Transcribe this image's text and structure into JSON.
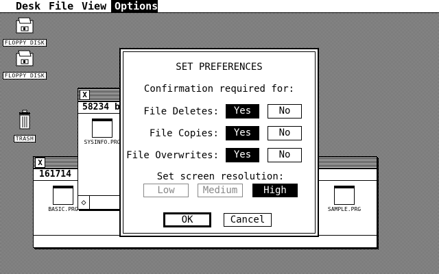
{
  "menu": {
    "items": [
      "Desk",
      "File",
      "View",
      "Options"
    ],
    "active_index": 3
  },
  "desktop": {
    "icons": [
      {
        "label": "FLOPPY DISK",
        "icon": "floppy-disk-icon"
      },
      {
        "label": "FLOPPY DISK",
        "icon": "floppy-disk-icon"
      },
      {
        "label": "TRASH",
        "icon": "trash-can-icon"
      }
    ]
  },
  "windows": {
    "back": {
      "info": "161714",
      "files": [
        "BASIC.PRG",
        "SAMPLE.PRG"
      ],
      "close_glyph": "X"
    },
    "front": {
      "info": "58234 b",
      "files": [
        "SYSINFO.PRG"
      ],
      "close_glyph": "X",
      "scroll_left_glyph": "◇"
    }
  },
  "dialog": {
    "title": "SET PREFERENCES",
    "subtitle": "Confirmation required for:",
    "rows": [
      {
        "label": "File Deletes:",
        "yes": "Yes",
        "no": "No",
        "selected": "yes"
      },
      {
        "label": "File Copies:",
        "yes": "Yes",
        "no": "No",
        "selected": "yes"
      },
      {
        "label": "File Overwrites:",
        "yes": "Yes",
        "no": "No",
        "selected": "yes"
      }
    ],
    "resolution_label": "Set screen resolution:",
    "resolutions": [
      {
        "label": "Low",
        "state": "disabled"
      },
      {
        "label": "Medium",
        "state": "disabled"
      },
      {
        "label": "High",
        "state": "selected"
      }
    ],
    "ok_label": "OK",
    "cancel_label": "Cancel"
  }
}
